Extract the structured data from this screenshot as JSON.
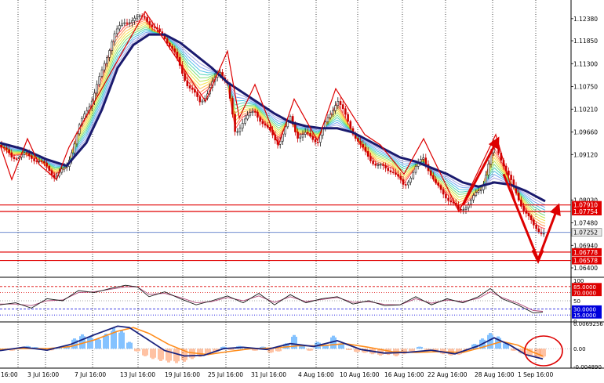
{
  "colors": {
    "background": "#ffffff",
    "bull_candle": "#1a1a1a",
    "bear_candle": "#cc0000",
    "slow_ma": "#1a1a6e",
    "zigzag": "#dd0000",
    "level_line": "#e00000",
    "current_price_line": "#5c7cc8",
    "macd_positive": "#3399ff",
    "macd_negative": "#ff9966",
    "macd_main": "#1a237e",
    "macd_signal": "#ff8c1a",
    "stoch_main": "#1a1a1a",
    "stoch_signal": "#b24a7a",
    "overbought": "#dd0000",
    "oversold": "#0000dd",
    "grid": "#000000",
    "label_red_bg": "#e00000",
    "label_current_bg": "#e8e8e8"
  },
  "price_axis": {
    "ticks": [
      "1.12380",
      "1.11850",
      "1.11300",
      "1.10750",
      "1.10210",
      "1.09660",
      "1.09120",
      "1.08030",
      "1.07480",
      "1.06940",
      "1.06400"
    ],
    "levels": [
      {
        "label": "1.07910"
      },
      {
        "label": "1.07754"
      },
      {
        "label": "1.06778"
      },
      {
        "label": "1.06578"
      }
    ],
    "current": "1.07252"
  },
  "oscillator_axis": {
    "labels": [
      "100",
      "85.0000",
      "70.0000",
      "50",
      "30.0000",
      "15.0000",
      "0"
    ]
  },
  "macd_axis": {
    "labels": [
      "0.0069256",
      "0.00",
      "-0.004890"
    ]
  },
  "time_axis": {
    "labels": [
      "16:00",
      "3 Jul 16:00",
      "7 Jul 16:00",
      "13 Jul 16:00",
      "19 Jul 16:00",
      "25 Jul 16:00",
      "31 Jul 16:00",
      "4 Aug 16:00",
      "10 Aug 16:00",
      "16 Aug 16:00",
      "22 Aug 16:00",
      "28 Aug 16:00",
      "1 Sep 16:00"
    ]
  },
  "chart_data": {
    "type": "line",
    "symbol": "",
    "price_series": [
      [
        0,
        1.0935
      ],
      [
        15,
        1.0905
      ],
      [
        30,
        1.0912
      ],
      [
        50,
        1.0898
      ],
      [
        70,
        1.086
      ],
      [
        85,
        1.088
      ],
      [
        100,
        1.0975
      ],
      [
        115,
        1.1035
      ],
      [
        130,
        1.111
      ],
      [
        145,
        1.12
      ],
      [
        160,
        1.1232
      ],
      [
        175,
        1.1238
      ],
      [
        185,
        1.1245
      ],
      [
        195,
        1.1215
      ],
      [
        210,
        1.1195
      ],
      [
        225,
        1.1145
      ],
      [
        240,
        1.1075
      ],
      [
        255,
        1.104
      ],
      [
        265,
        1.106
      ],
      [
        280,
        1.1115
      ],
      [
        290,
        1.108
      ],
      [
        300,
        1.096
      ],
      [
        310,
        1.0995
      ],
      [
        325,
        1.1015
      ],
      [
        340,
        1.0975
      ],
      [
        355,
        1.094
      ],
      [
        370,
        1.1
      ],
      [
        380,
        1.0955
      ],
      [
        390,
        1.096
      ],
      [
        405,
        1.0945
      ],
      [
        420,
        1.1005
      ],
      [
        430,
        1.1045
      ],
      [
        445,
        1.0985
      ],
      [
        460,
        1.093
      ],
      [
        480,
        1.0885
      ],
      [
        500,
        1.0875
      ],
      [
        515,
        1.0835
      ],
      [
        530,
        1.088
      ],
      [
        540,
        1.0905
      ],
      [
        555,
        1.084
      ],
      [
        570,
        1.081
      ],
      [
        585,
        1.0775
      ],
      [
        600,
        1.08
      ],
      [
        615,
        1.0835
      ],
      [
        630,
        1.094
      ],
      [
        642,
        1.089
      ],
      [
        655,
        1.083
      ],
      [
        668,
        1.078
      ],
      [
        680,
        1.074
      ],
      [
        692,
        1.0725
      ]
    ],
    "slow_ma": [
      [
        0,
        1.094
      ],
      [
        30,
        1.0925
      ],
      [
        60,
        1.09
      ],
      [
        85,
        1.0885
      ],
      [
        110,
        1.094
      ],
      [
        130,
        1.102
      ],
      [
        150,
        1.112
      ],
      [
        170,
        1.1175
      ],
      [
        190,
        1.12
      ],
      [
        210,
        1.12
      ],
      [
        230,
        1.118
      ],
      [
        250,
        1.115
      ],
      [
        270,
        1.112
      ],
      [
        290,
        1.1085
      ],
      [
        310,
        1.106
      ],
      [
        330,
        1.1035
      ],
      [
        350,
        1.101
      ],
      [
        370,
        1.099
      ],
      [
        390,
        1.098
      ],
      [
        410,
        1.0975
      ],
      [
        430,
        1.0975
      ],
      [
        450,
        1.0965
      ],
      [
        470,
        1.0945
      ],
      [
        490,
        1.0925
      ],
      [
        510,
        1.0905
      ],
      [
        530,
        1.0895
      ],
      [
        550,
        1.088
      ],
      [
        570,
        1.0865
      ],
      [
        590,
        1.0845
      ],
      [
        610,
        1.0835
      ],
      [
        630,
        1.0845
      ],
      [
        650,
        1.084
      ],
      [
        670,
        1.0825
      ],
      [
        685,
        1.081
      ],
      [
        695,
        1.08
      ]
    ],
    "zigzag": [
      [
        0,
        1.0935
      ],
      [
        15,
        1.0852
      ],
      [
        35,
        1.095
      ],
      [
        50,
        1.0888
      ],
      [
        72,
        1.0852
      ],
      [
        88,
        1.093
      ],
      [
        185,
        1.1255
      ],
      [
        262,
        1.104
      ],
      [
        290,
        1.116
      ],
      [
        305,
        1.1
      ],
      [
        325,
        1.108
      ],
      [
        355,
        1.0935
      ],
      [
        375,
        1.1045
      ],
      [
        392,
        1.0988
      ],
      [
        405,
        1.0945
      ],
      [
        428,
        1.107
      ],
      [
        465,
        1.096
      ],
      [
        485,
        1.0935
      ],
      [
        515,
        1.0865
      ],
      [
        540,
        1.095
      ],
      [
        585,
        1.0775
      ],
      [
        632,
        1.096
      ],
      [
        660,
        1.078
      ]
    ],
    "arrows": [
      {
        "from": [
          590,
          1.079
        ],
        "to": [
          635,
          1.095
        ]
      },
      {
        "from": [
          642,
          1.0865
        ],
        "to": [
          686,
          1.066
        ]
      },
      {
        "from": [
          686,
          1.066
        ],
        "to": [
          712,
          1.079
        ]
      }
    ],
    "levels": [
      1.0791,
      1.07754,
      1.06778,
      1.06578
    ],
    "current_price": 1.07252,
    "oscillator": {
      "overbought": [
        85,
        70
      ],
      "oversold": [
        30,
        15
      ],
      "main": [
        [
          0,
          40
        ],
        [
          20,
          45
        ],
        [
          40,
          32
        ],
        [
          60,
          55
        ],
        [
          80,
          50
        ],
        [
          100,
          75
        ],
        [
          120,
          70
        ],
        [
          140,
          80
        ],
        [
          160,
          88
        ],
        [
          175,
          84
        ],
        [
          190,
          60
        ],
        [
          210,
          72
        ],
        [
          230,
          55
        ],
        [
          250,
          40
        ],
        [
          270,
          50
        ],
        [
          290,
          62
        ],
        [
          310,
          45
        ],
        [
          330,
          68
        ],
        [
          350,
          40
        ],
        [
          370,
          65
        ],
        [
          390,
          45
        ],
        [
          410,
          55
        ],
        [
          430,
          60
        ],
        [
          450,
          42
        ],
        [
          470,
          50
        ],
        [
          490,
          38
        ],
        [
          510,
          40
        ],
        [
          530,
          60
        ],
        [
          550,
          40
        ],
        [
          570,
          55
        ],
        [
          590,
          45
        ],
        [
          610,
          60
        ],
        [
          625,
          80
        ],
        [
          640,
          55
        ],
        [
          660,
          40
        ],
        [
          680,
          20
        ],
        [
          692,
          22
        ]
      ],
      "signal": [
        [
          0,
          42
        ],
        [
          20,
          42
        ],
        [
          40,
          38
        ],
        [
          60,
          50
        ],
        [
          80,
          52
        ],
        [
          100,
          70
        ],
        [
          120,
          72
        ],
        [
          140,
          78
        ],
        [
          160,
          84
        ],
        [
          175,
          84
        ],
        [
          190,
          66
        ],
        [
          210,
          68
        ],
        [
          230,
          58
        ],
        [
          250,
          45
        ],
        [
          270,
          48
        ],
        [
          290,
          58
        ],
        [
          310,
          50
        ],
        [
          330,
          62
        ],
        [
          350,
          46
        ],
        [
          370,
          60
        ],
        [
          390,
          48
        ],
        [
          410,
          53
        ],
        [
          430,
          58
        ],
        [
          450,
          46
        ],
        [
          470,
          48
        ],
        [
          490,
          41
        ],
        [
          510,
          40
        ],
        [
          530,
          55
        ],
        [
          550,
          44
        ],
        [
          570,
          52
        ],
        [
          590,
          48
        ],
        [
          610,
          56
        ],
        [
          625,
          72
        ],
        [
          640,
          58
        ],
        [
          660,
          44
        ],
        [
          680,
          26
        ],
        [
          692,
          24
        ]
      ]
    },
    "macd": {
      "bars": [
        [
          5,
          -0.0004
        ],
        [
          15,
          -0.0006
        ],
        [
          25,
          0.0003
        ],
        [
          35,
          0.0008
        ],
        [
          45,
          0.0005
        ],
        [
          55,
          -0.0002
        ],
        [
          65,
          -0.0005
        ],
        [
          75,
          0.0004
        ],
        [
          85,
          0.001
        ],
        [
          95,
          0.003
        ],
        [
          105,
          0.0042
        ],
        [
          115,
          0.0036
        ],
        [
          125,
          0.003
        ],
        [
          135,
          0.0044
        ],
        [
          145,
          0.006
        ],
        [
          155,
          0.0054
        ],
        [
          165,
          0.002
        ],
        [
          175,
          -0.0008
        ],
        [
          185,
          -0.0022
        ],
        [
          195,
          -0.003
        ],
        [
          205,
          -0.0036
        ],
        [
          215,
          -0.004
        ],
        [
          225,
          -0.0042
        ],
        [
          235,
          -0.0038
        ],
        [
          245,
          -0.003
        ],
        [
          255,
          -0.0024
        ],
        [
          265,
          -0.0018
        ],
        [
          275,
          -0.001
        ],
        [
          285,
          0.0006
        ],
        [
          295,
          -0.0004
        ],
        [
          305,
          0.0008
        ],
        [
          315,
          0.0004
        ],
        [
          325,
          -0.0006
        ],
        [
          335,
          0.0006
        ],
        [
          345,
          -0.0012
        ],
        [
          355,
          -0.0008
        ],
        [
          365,
          0.0016
        ],
        [
          375,
          0.004
        ],
        [
          385,
          0.0012
        ],
        [
          395,
          -0.0006
        ],
        [
          405,
          0.002
        ],
        [
          415,
          0.001
        ],
        [
          425,
          0.0038
        ],
        [
          435,
          0.0016
        ],
        [
          445,
          -0.0004
        ],
        [
          455,
          -0.001
        ],
        [
          465,
          -0.0012
        ],
        [
          475,
          -0.0016
        ],
        [
          485,
          -0.002
        ],
        [
          495,
          -0.0018
        ],
        [
          505,
          -0.0022
        ],
        [
          515,
          -0.0016
        ],
        [
          525,
          -0.0008
        ],
        [
          535,
          0.0006
        ],
        [
          545,
          -0.0004
        ],
        [
          555,
          -0.001
        ],
        [
          565,
          -0.0016
        ],
        [
          575,
          -0.002
        ],
        [
          585,
          -0.0018
        ],
        [
          595,
          -0.0006
        ],
        [
          605,
          0.0014
        ],
        [
          615,
          0.003
        ],
        [
          625,
          0.0046
        ],
        [
          635,
          0.0036
        ],
        [
          645,
          0.0018
        ],
        [
          655,
          -0.0006
        ],
        [
          665,
          -0.0014
        ],
        [
          675,
          -0.0022
        ],
        [
          685,
          -0.0028
        ],
        [
          692,
          -0.0026
        ]
      ],
      "main": [
        [
          0,
          -0.0005
        ],
        [
          30,
          0.0004
        ],
        [
          60,
          -0.0004
        ],
        [
          90,
          0.0012
        ],
        [
          120,
          0.0038
        ],
        [
          150,
          0.0062
        ],
        [
          165,
          0.0058
        ],
        [
          185,
          0.003
        ],
        [
          210,
          -0.0005
        ],
        [
          235,
          -0.002
        ],
        [
          260,
          -0.0018
        ],
        [
          285,
          0.0
        ],
        [
          310,
          0.0004
        ],
        [
          340,
          -0.0002
        ],
        [
          370,
          0.0014
        ],
        [
          400,
          0.0006
        ],
        [
          430,
          0.0022
        ],
        [
          460,
          -0.0002
        ],
        [
          490,
          -0.0012
        ],
        [
          520,
          -0.001
        ],
        [
          550,
          -0.0004
        ],
        [
          580,
          -0.0014
        ],
        [
          610,
          0.0008
        ],
        [
          630,
          0.003
        ],
        [
          650,
          0.001
        ],
        [
          670,
          -0.0016
        ],
        [
          692,
          -0.0028
        ]
      ],
      "signal": [
        [
          0,
          -0.0002
        ],
        [
          30,
          0.0001
        ],
        [
          60,
          0.0
        ],
        [
          90,
          0.0006
        ],
        [
          120,
          0.0024
        ],
        [
          150,
          0.0048
        ],
        [
          170,
          0.0058
        ],
        [
          190,
          0.0042
        ],
        [
          215,
          0.0012
        ],
        [
          240,
          -0.001
        ],
        [
          265,
          -0.0016
        ],
        [
          290,
          -0.0008
        ],
        [
          320,
          0.0
        ],
        [
          350,
          0.0002
        ],
        [
          380,
          0.0008
        ],
        [
          410,
          0.0008
        ],
        [
          440,
          0.0014
        ],
        [
          470,
          0.0004
        ],
        [
          500,
          -0.0008
        ],
        [
          530,
          -0.001
        ],
        [
          560,
          -0.0008
        ],
        [
          590,
          -0.001
        ],
        [
          615,
          0.0004
        ],
        [
          640,
          0.002
        ],
        [
          660,
          0.001
        ],
        [
          680,
          -0.001
        ],
        [
          692,
          -0.002
        ]
      ]
    }
  }
}
